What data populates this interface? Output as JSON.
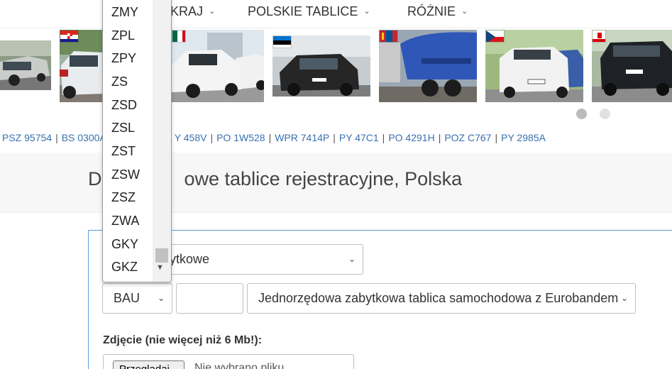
{
  "nav": {
    "items": [
      {
        "label": "KRAJ"
      },
      {
        "label": "POLSKIE TABLICE"
      },
      {
        "label": "RÓŻNIE"
      }
    ],
    "chevron": "chevron-down-icon"
  },
  "carousel": {
    "slides": [
      {
        "flag": "none",
        "subject": "silver SUV"
      },
      {
        "flag": "croatia",
        "subject": "white crossover"
      },
      {
        "flag": "mexico",
        "subject": "white hatchbacks"
      },
      {
        "flag": "estonia",
        "subject": "dark hatchback"
      },
      {
        "flag": "mongolia",
        "subject": "blue tanker truck"
      },
      {
        "flag": "czech",
        "subject": "white sedan"
      },
      {
        "flag": "gibraltar",
        "subject": "black SUV"
      }
    ],
    "dots": [
      {
        "active": true
      },
      {
        "active": false
      }
    ]
  },
  "plates": [
    "PSZ 95754",
    "BS 0300A",
    "Y 458V",
    "PO 1W528",
    "WPR 7414P",
    "PY 47C1",
    "PO 4291H",
    "POZ C767",
    "PY 2985A"
  ],
  "page": {
    "title_start": "D",
    "title_end": "owe tablice rejestracyjne, Polska"
  },
  "form": {
    "category_select_value": "ytkowe",
    "code_select_value": "BAU",
    "plate_input_value": "",
    "type_select_value": "Jednorzędowa zabytkowa tablica samochodowa z Eurobandem",
    "photo_label": "Zdjęcie (nie więcej niż 6 Mb!):",
    "file_button_label": "Przeglądaj...",
    "file_status": "Nie wybrano pliku."
  },
  "dropdown": {
    "options": [
      "ZMY",
      "ZPL",
      "ZPY",
      "ZS",
      "ZSD",
      "ZSL",
      "ZST",
      "ZSW",
      "ZSZ",
      "ZWA",
      "GKY",
      "GKZ"
    ]
  },
  "colors": {
    "link": "#3a6fb0",
    "form_border": "#5b9bd5",
    "band": "#f7f7f7"
  }
}
